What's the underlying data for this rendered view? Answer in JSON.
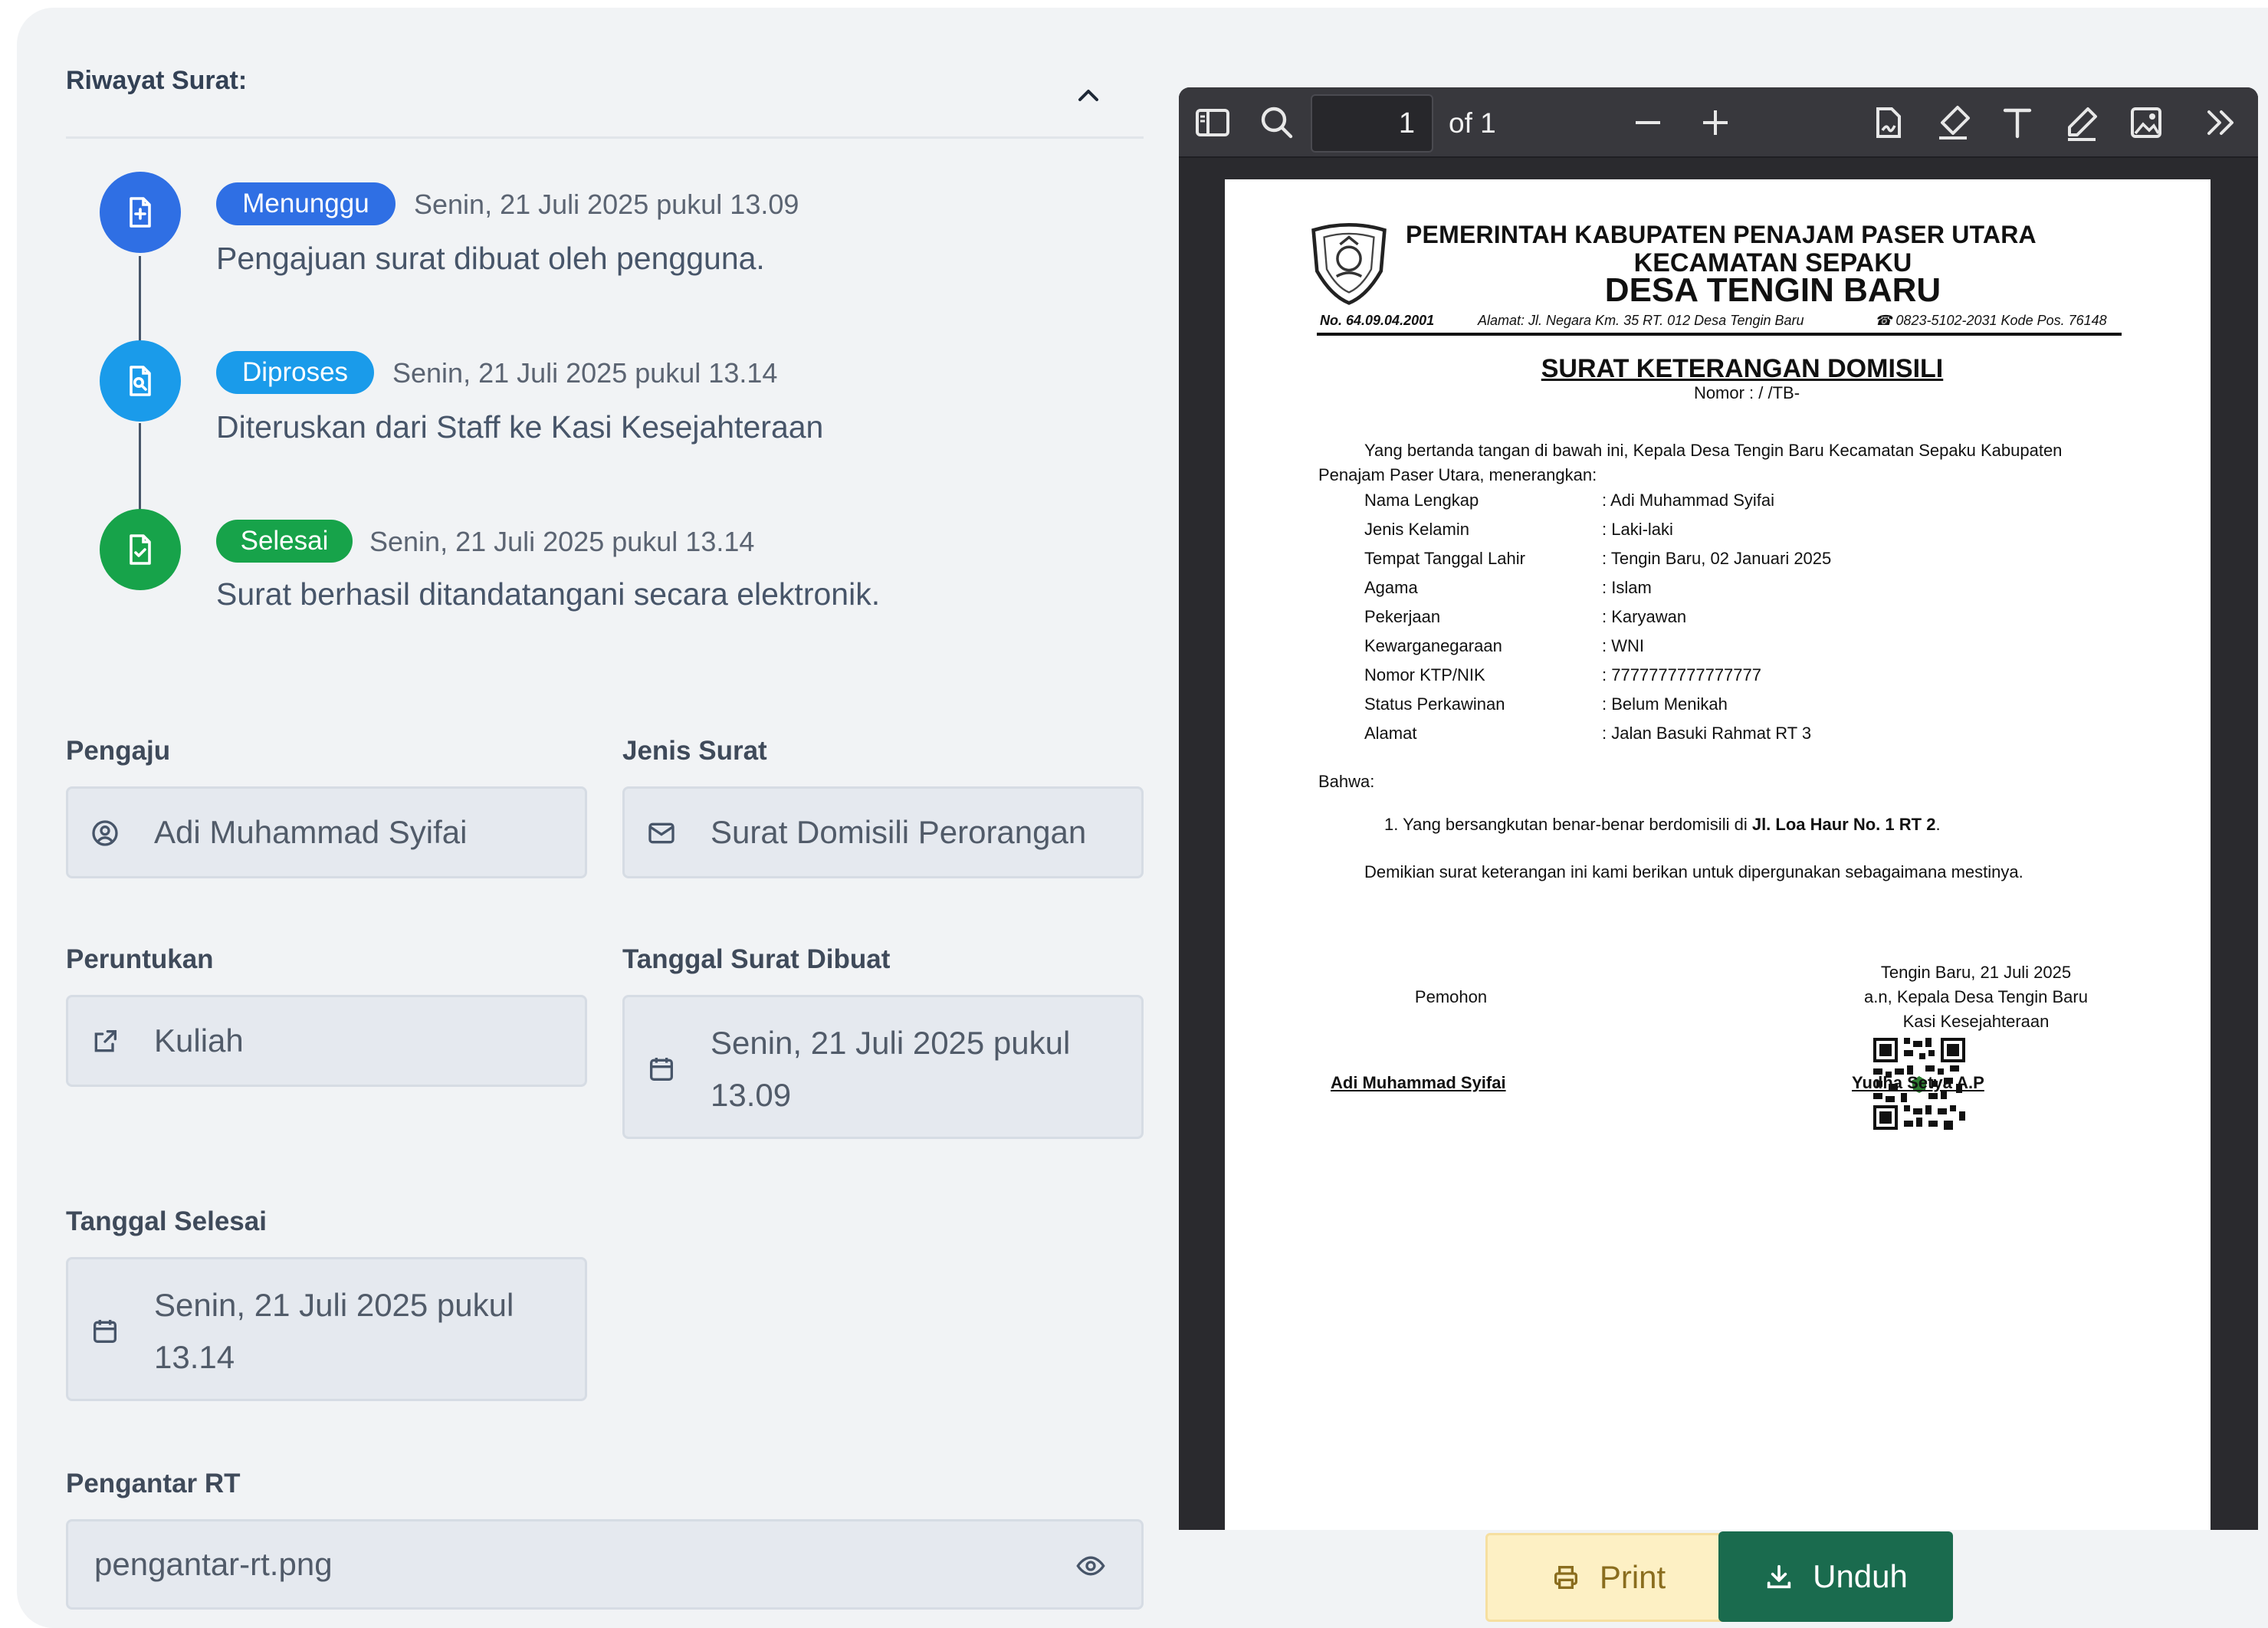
{
  "history": {
    "title": "Riwayat Surat:",
    "items": [
      {
        "status": "Menunggu",
        "time": "Senin, 21 Juli 2025 pukul 13.09",
        "desc": "Pengajuan surat dibuat oleh pengguna.",
        "color": "#2f6fe4"
      },
      {
        "status": "Diproses",
        "time": "Senin, 21 Juli 2025 pukul 13.14",
        "desc": "Diteruskan dari Staff ke Kasi Kesejahteraan",
        "color": "#1a9bea"
      },
      {
        "status": "Selesai",
        "time": "Senin, 21 Juli 2025 pukul 13.14",
        "desc": "Surat berhasil ditandatangani secara elektronik.",
        "color": "#17a34a"
      }
    ]
  },
  "form": {
    "pengaju": {
      "label": "Pengaju",
      "value": "Adi Muhammad Syifai",
      "icon": "user-circle-icon"
    },
    "jenis_surat": {
      "label": "Jenis Surat",
      "value": "Surat Domisili Perorangan",
      "icon": "envelope-icon"
    },
    "peruntukan": {
      "label": "Peruntukan",
      "value": "Kuliah",
      "icon": "share-icon"
    },
    "tanggal_dibuat": {
      "label": "Tanggal Surat Dibuat",
      "value_line1": "Senin, 21 Juli 2025 pukul",
      "value_line2": "13.09",
      "icon": "calendar-icon"
    },
    "tanggal_selesai": {
      "label": "Tanggal Selesai",
      "value_line1": "Senin, 21 Juli 2025 pukul",
      "value_line2": "13.14",
      "icon": "calendar-icon"
    },
    "pengantar_rt": {
      "label": "Pengantar RT",
      "value": "pengantar-rt.png",
      "icon": "eye-icon"
    }
  },
  "viewer": {
    "page_current": "1",
    "page_total_label": "of 1",
    "document": {
      "header1": "PEMERINTAH KABUPATEN PENAJAM PASER UTARA",
      "header2": "KECAMATAN SEPAKU",
      "header3": "DESA TENGIN BARU",
      "meta_no": "No. 64.09.04.2001",
      "meta_alamat": "Alamat: Jl. Negara Km. 35 RT. 012 Desa Tengin Baru",
      "meta_phone": "☎ 0823-5102-2031 Kode Pos. 76148",
      "title": "SURAT KETERANGAN DOMISILI",
      "nomor": "Nomor :          /        /TB-",
      "intro": "Yang bertanda tangan di bawah ini, Kepala Desa Tengin Baru Kecamatan Sepaku Kabupaten Penajam Paser Utara, menerangkan:",
      "rows": [
        {
          "k": "Nama Lengkap",
          "v": ": Adi Muhammad Syifai"
        },
        {
          "k": "Jenis Kelamin",
          "v": ": Laki-laki"
        },
        {
          "k": "Tempat Tanggal Lahir",
          "v": ": Tengin Baru, 02 Januari 2025"
        },
        {
          "k": "Agama",
          "v": ": Islam"
        },
        {
          "k": "Pekerjaan",
          "v": ": Karyawan"
        },
        {
          "k": "Kewarganegaraan",
          "v": ": WNI"
        },
        {
          "k": "Nomor KTP/NIK",
          "v": ": 7777777777777777"
        },
        {
          "k": "Status Perkawinan",
          "v": ": Belum Menikah"
        },
        {
          "k": "Alamat",
          "v": ": Jalan Basuki Rahmat RT 3"
        }
      ],
      "bahwa": "Bahwa:",
      "point_prefix": "1.  Yang bersangkutan benar-benar berdomisili di ",
      "point_bold": "Jl. Loa Haur No. 1 RT 2",
      "point_suffix": ".",
      "closing": "Demikian surat keterangan ini kami berikan untuk dipergunakan sebagaimana mestinya.",
      "place_date": "Tengin Baru, 21 Juli 2025",
      "an": "a.n, Kepala Desa Tengin Baru",
      "kasi": "Kasi Kesejahteraan",
      "pemohon": "Pemohon",
      "sign_left": "Adi Muhammad Syifai",
      "sign_right": "Yudha Setya A.P"
    },
    "print_label": "Print",
    "download_label": "Unduh"
  }
}
